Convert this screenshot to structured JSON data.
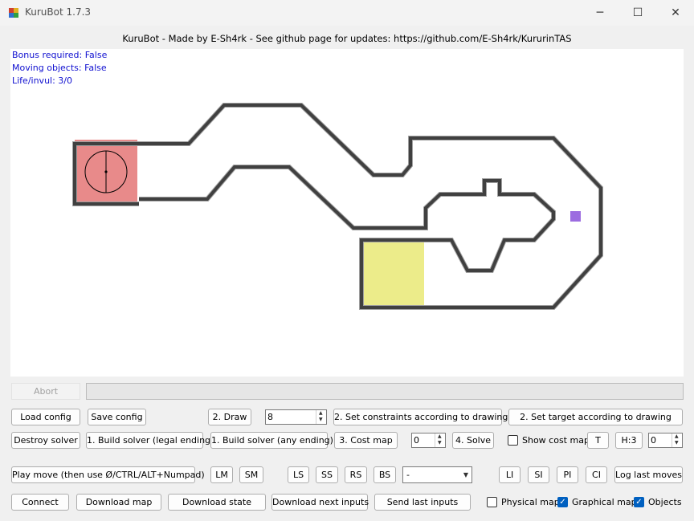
{
  "window": {
    "title": "KuruBot 1.7.3",
    "minimize_glyph": "─",
    "maximize_glyph": "☐",
    "close_glyph": "✕"
  },
  "header": "KuruBot - Made by E-Sh4rk - See github page for updates: https://github.com/E-Sh4rk/KururinTAS",
  "canvas": {
    "info": {
      "bonus": "Bonus required: False",
      "moving": "Moving objects: False",
      "life": "Life/invul: 3/0"
    },
    "colors": {
      "wall": "#404040",
      "wall_outline": "#a0a0a0",
      "start_zone": "#e88a8a",
      "goal_zone": "#ecec8a",
      "object": "#9c6ce0"
    }
  },
  "progress": {
    "abort_label": "Abort",
    "value": 0
  },
  "row1": {
    "load_config": "Load config",
    "save_config": "Save config",
    "draw": "2. Draw",
    "draw_value": "8",
    "set_constraints": "2. Set constraints according to drawing",
    "set_target": "2. Set target according to drawing"
  },
  "row2": {
    "destroy_solver": "Destroy solver",
    "build_legal": "1. Build solver (legal ending)",
    "build_any": "1. Build solver (any ending)",
    "cost_map": "3. Cost map",
    "cost_value": "0",
    "solve": "4. Solve",
    "show_cost_map": "Show cost map",
    "t": "T",
    "h3": "H:3",
    "h_value": "0"
  },
  "row3": {
    "play_move": "Play move (then use Ø/CTRL/ALT+Numpad)",
    "lm": "LM",
    "sm": "SM",
    "ls": "LS",
    "ss": "SS",
    "rs": "RS",
    "bs": "BS",
    "combo_value": "-",
    "li": "LI",
    "si": "SI",
    "pi": "PI",
    "ci": "CI",
    "log_last_moves": "Log last moves"
  },
  "row4": {
    "connect": "Connect",
    "download_map": "Download map",
    "download_state": "Download state",
    "download_next_inputs": "Download next inputs",
    "send_last_inputs": "Send last inputs",
    "physical_map": "Physical map",
    "physical_map_checked": false,
    "graphical_map": "Graphical map",
    "graphical_map_checked": true,
    "objects": "Objects",
    "objects_checked": true
  }
}
